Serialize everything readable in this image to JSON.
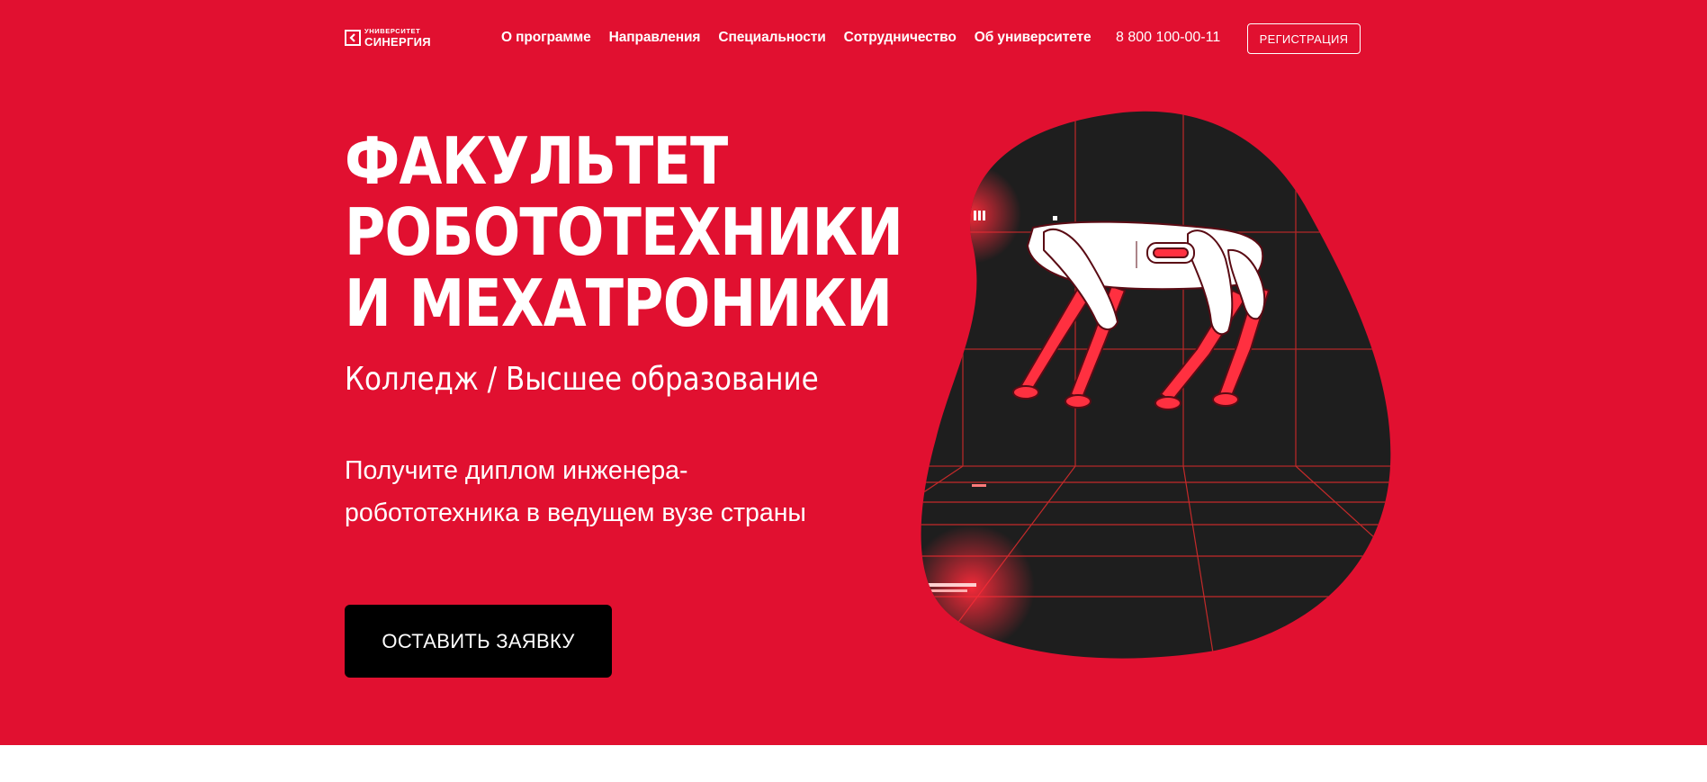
{
  "header": {
    "logo": {
      "top": "УНИВЕРСИТЕТ",
      "bottom": "СИНЕРГИЯ"
    },
    "nav": [
      "О программе",
      "Направления",
      "Специальности",
      "Сотрудничество",
      "Об университете"
    ],
    "phone": "8 800 100-00-11",
    "register_label": "РЕГИСТРАЦИЯ"
  },
  "hero": {
    "title_lines": [
      "ФАКУЛЬТЕТ",
      "РОБОТОТЕХНИКИ",
      "И МЕХАТРОНИКИ"
    ],
    "subtitle": "Колледж / Высшее образование",
    "description_lines": [
      "Получите диплом инженера-",
      "робототехника в ведущем вузе страны"
    ],
    "cta_label": "ОСТАВИТЬ ЗАЯВКУ"
  },
  "colors": {
    "brand_red": "#e11030",
    "dark": "#1e1e1e",
    "cta_bg": "#000000",
    "text": "#ffffff"
  },
  "icons": {
    "logo": "synergy-logo-icon",
    "illustration": "robot-dog-illustration"
  }
}
